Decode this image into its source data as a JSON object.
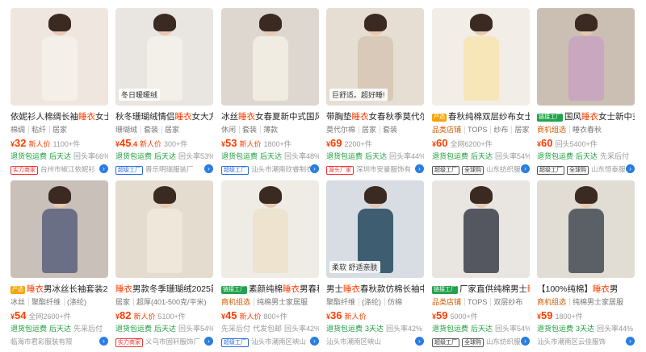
{
  "products": [
    {
      "title_pre": "依妮衫人棉绸长袖",
      "title_hl": "睡衣",
      "title_post": "女士",
      "badge": "",
      "badge_color": "",
      "tags": [
        "棉绸",
        "粘纤",
        "居家"
      ],
      "shop": "",
      "shop_brand": "",
      "price_int": "32",
      "price_dec": "",
      "newp": "新人价",
      "sold": "1100+件",
      "svc": [
        "退货包运费",
        "后天达"
      ],
      "svc_grey": "回头率66%",
      "ship_label": "实力商家",
      "ship_label_style": "red",
      "ship_label2": "",
      "location": "台州市椒江依妮衫",
      "img_bg": "#efe7df",
      "outfit": "#f4efe9"
    },
    {
      "title_pre": "秋冬珊瑚绒情侣",
      "title_hl": "睡衣",
      "title_post": "女大方领",
      "badge": "",
      "badge_color": "",
      "tags": [
        "珊瑚绒",
        "套装",
        "居家"
      ],
      "shop": "",
      "shop_brand": "",
      "price_int": "45",
      "price_dec": ".4",
      "newp": "新人价",
      "sold": "300+件",
      "svc": [
        "退货包运费",
        "后天达"
      ],
      "svc_grey": "回头率53%",
      "ship_label": "超级工厂",
      "ship_label_style": "blue",
      "ship_label2": "",
      "location": "晋乐明瑞服装厂",
      "img_bg": "#e9e5e0",
      "outfit": "#f3f0ea",
      "overlay": "冬日暖暖绒"
    },
    {
      "title_pre": "冰丝",
      "title_hl": "睡衣",
      "title_post": "女春夏新中式国风",
      "badge": "",
      "badge_color": "",
      "tags": [
        "休闲",
        "套装",
        "薄款"
      ],
      "shop": "",
      "shop_brand": "",
      "price_int": "53",
      "price_dec": "",
      "newp": "新人价",
      "sold": "1800+件",
      "svc": [
        "退货包运费",
        "后天达"
      ],
      "svc_grey": "回头率48%",
      "ship_label": "超级工厂",
      "ship_label_style": "blue",
      "ship_label2": "",
      "location": "汕头市潮南欣睿制衣厂",
      "img_bg": "#ddd7cf",
      "outfit": "#f1ece2"
    },
    {
      "title_pre": "带胸垫",
      "title_hl": "睡衣",
      "title_post": "女春秋季莫代尔",
      "badge": "",
      "badge_color": "",
      "tags": [
        "莫代尔棉",
        "居家",
        "套装"
      ],
      "shop": "",
      "shop_brand": "",
      "price_int": "69",
      "price_dec": "",
      "newp": "",
      "sold": "2200+件",
      "svc": [
        "退货包运费",
        "后天达"
      ],
      "svc_grey": "回头率44%",
      "ship_label": "源头厂家",
      "ship_label_style": "red",
      "ship_label2": "",
      "location": "深圳市安曼服饰有",
      "img_bg": "#e6ddd3",
      "outfit": "#d8c9b8",
      "overlay": "巨舒适。超好睡!"
    },
    {
      "title_pre": "春秋纯棉双层纱布女士",
      "title_hl": "",
      "title_post": "",
      "badge": "严选",
      "badge_color": "y",
      "tags": [],
      "shop": "品类店铺",
      "shop_brand": "TOPS",
      "extra_tags": [
        "纱布",
        "居家"
      ],
      "price_int": "60",
      "price_dec": "",
      "newp": "",
      "sold": "全网6200+件",
      "svc": [
        "退货包运费",
        "后天达"
      ],
      "svc_grey": "回头率54%",
      "ship_label": "超级工厂",
      "ship_label_style": "dark",
      "ship_label2": "全球购",
      "location": "山东纺织服",
      "img_bg": "#f2ede6",
      "outfit": "#f6e6b8"
    },
    {
      "title_pre": "国风",
      "title_hl": "睡衣",
      "title_post": "女士新中式",
      "badge": "链接工厂",
      "badge_color": "g",
      "tags": [],
      "shop": "商机组选",
      "shop_brand": "睡衣春秋",
      "shop_is_text": true,
      "price_int": "60",
      "price_dec": "",
      "newp": "",
      "sold": "回头5400+件",
      "svc": [
        "退货包运费",
        "后天达"
      ],
      "svc_grey": "先采后付",
      "ship_label": "超级工厂",
      "ship_label_style": "dark",
      "ship_label2": "全球购",
      "location": "山东恒泰服",
      "img_bg": "#cbbfb4",
      "outfit": "#c9a7bf"
    },
    {
      "title_pre": "",
      "title_hl": "睡衣",
      "title_post": "男冰丝长袖套装20",
      "badge": "严选",
      "badge_color": "y",
      "tags": [
        "冰丝",
        "聚酯纤维",
        "(涤纶)"
      ],
      "shop": "",
      "shop_brand": "",
      "price_int": "54",
      "price_dec": "",
      "newp": "",
      "sold": "全网2600+件",
      "svc": [
        "退货包运费",
        "后天达"
      ],
      "svc_grey": "先采后付",
      "ship_label": "",
      "ship_label_style": "",
      "ship_label2": "",
      "location": "临海市君彩服装有限",
      "img_bg": "#c9c0b9",
      "outfit": "#6b6f86"
    },
    {
      "title_pre": "",
      "title_hl": "睡衣",
      "title_post": "男款冬季珊瑚绒2025新",
      "badge": "",
      "badge_color": "",
      "tags": [
        "居家",
        "超厚(401-500克/平米)"
      ],
      "shop": "",
      "shop_brand": "",
      "price_int": "82",
      "price_dec": "",
      "newp": "新人价",
      "sold": "5100+件",
      "svc": [
        "退货包运费",
        "后天达"
      ],
      "svc_grey": "回头率54%",
      "ship_label": "实力商家",
      "ship_label_style": "red",
      "ship_label2": "",
      "location": "义乌市固轩服饰厂",
      "img_bg": "#e4dccf",
      "outfit": "#efe7d9"
    },
    {
      "title_pre": "素颜纯棉",
      "title_hl": "睡衣",
      "title_post": "男春秋",
      "badge": "链接工厂",
      "badge_color": "g",
      "tags": [],
      "shop": "商机组选",
      "shop_brand": "纯棉男士家居服",
      "shop_is_text": true,
      "price_int": "45",
      "price_dec": "",
      "newp": "新人价",
      "sold": "800+件",
      "svc_grey_first": [
        "先采后付",
        "代发包邮"
      ],
      "svc": [],
      "svc_grey": "回头率42%",
      "ship_label": "超级工厂",
      "ship_label_style": "blue",
      "ship_label2": "",
      "location": "汕头市潮南区峡山",
      "img_bg": "#efece6",
      "outfit": "#ede3cf"
    },
    {
      "title_pre": "男士",
      "title_hl": "睡衣",
      "title_post": "春秋款仿棉长袖中",
      "badge": "",
      "badge_color": "",
      "tags": [
        "聚酯纤维",
        "(涤纶)",
        "仿棉"
      ],
      "shop": "",
      "shop_brand": "",
      "price_int": "36",
      "price_dec": "",
      "newp": "新人价",
      "sold": "",
      "svc": [
        "退货包运费",
        "3天达"
      ],
      "svc_grey": "回头率42%",
      "ship_label": "",
      "ship_label_style": "",
      "ship_label2": "",
      "location": "汕头市潮南区峡山",
      "img_bg": "#d7dde2",
      "outfit": "#3f5d70",
      "overlay": "柔软 舒适亲肤"
    },
    {
      "title_pre": "厂家直供纯棉男士",
      "title_hl": "睡",
      "title_post": "",
      "badge": "链接工厂",
      "badge_color": "g",
      "tags": [],
      "shop": "品类店铺",
      "shop_brand": "TOPS",
      "extra_tags": [
        "双层纱布"
      ],
      "price_int": "59",
      "price_dec": "",
      "newp": "",
      "sold": "5000+件",
      "svc": [
        "退货包运费",
        "后天达"
      ],
      "svc_grey": "回头率54%",
      "ship_label": "超级工厂",
      "ship_label_style": "dark",
      "ship_label2": "全球购",
      "location": "山东纺织服",
      "img_bg": "#e9e6e1",
      "outfit": "#555760"
    },
    {
      "title_pre": "【100%纯棉】",
      "title_hl": "睡衣",
      "title_post": "男",
      "badge": "",
      "badge_color": "",
      "tags": [],
      "shop": "商机组选",
      "shop_brand": "纯棉男士家居服",
      "shop_is_text": true,
      "price_int": "59",
      "price_dec": "",
      "newp": "",
      "sold": "1800+件",
      "svc": [
        "退货包运费",
        "3天达"
      ],
      "svc_grey": "回头率44%",
      "ship_label": "",
      "ship_label_style": "",
      "ship_label2": "",
      "location": "汕头市潮南区云佳服饰",
      "img_bg": "#e1ddd5",
      "outfit": "#5a6066"
    }
  ]
}
